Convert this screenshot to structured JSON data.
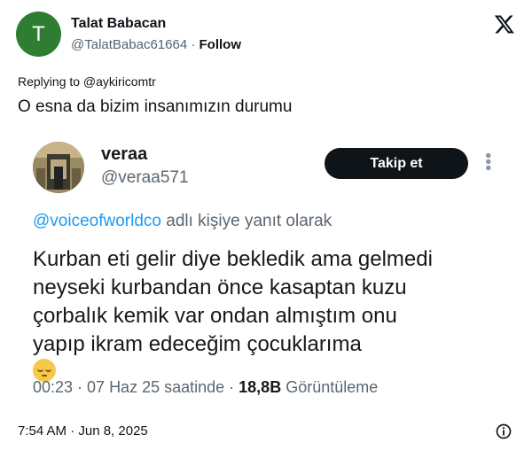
{
  "author": {
    "avatar_letter": "T",
    "name": "Talat Babacan",
    "handle": "@TalatBabac61664",
    "separator": "·",
    "follow_label": "Follow"
  },
  "replying_to": "Replying to @aykiricomtr",
  "tweet_text": "O esna da bizim insanımızın durumu",
  "embedded": {
    "name": "veraa",
    "handle": "@veraa571",
    "follow_button": "Takip et",
    "reply_mention": "@voiceofworldco",
    "reply_suffix": " adlı kişiye yanıt olarak",
    "body_lines": [
      "Kurban eti gelir diye bekledik ama gelmedi",
      "neyseki kurbandan önce kasaptan kuzu",
      "çorbalık kemik var ondan almıştım  onu",
      "yapıp ikram edeceğim çocuklarıma"
    ],
    "emoji": "pensive-face",
    "meta_time": "00:23 · 07 Haz 25 saatinde · ",
    "meta_views": "18,8B",
    "meta_views_label": " Görüntüleme"
  },
  "timestamp": "7:54 AM · Jun 8, 2025",
  "icons": {
    "x_logo": "x-logo-icon",
    "info": "info-icon",
    "more": "more-vertical-icon"
  },
  "colors": {
    "avatar_bg": "#2e7d32",
    "link": "#1d9bf0",
    "button_bg": "#0f1419",
    "secondary_text": "#536471"
  }
}
